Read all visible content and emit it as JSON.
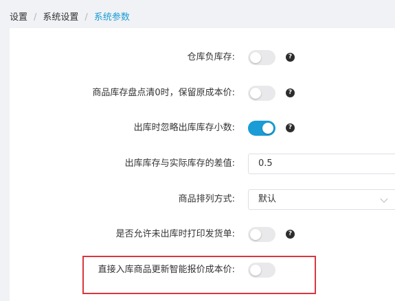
{
  "breadcrumb": {
    "items": [
      "设置",
      "系统设置"
    ],
    "current": "系统参数",
    "separator": "/"
  },
  "settings": {
    "negative_stock": {
      "label": "仓库负库存:",
      "enabled": false,
      "help_icon": "question-circle-icon"
    },
    "keep_cost_on_zero_stock": {
      "label": "商品库存盘点清0时，保留原成本价:",
      "enabled": false,
      "help_icon": "question-circle-icon"
    },
    "ignore_stock_decimals": {
      "label": "出库时忽略出库库存小数:",
      "enabled": true,
      "help_icon": "question-circle-icon"
    },
    "stock_diff": {
      "label": "出库库存与实际库存的差值:",
      "value": "0.5"
    },
    "sort_method": {
      "label": "商品排列方式:",
      "value": "默认",
      "icon": "chevron-down-icon"
    },
    "print_before_outbound": {
      "label": "是否允许未出库时打印发货单:",
      "enabled": false,
      "help_icon": "question-circle-icon"
    },
    "update_quote_cost": {
      "label": "直接入库商品更新智能报价成本价:",
      "enabled": false
    }
  },
  "help_glyph": "?",
  "colors": {
    "accent": "#1a9cd6",
    "toggle_off": "#e9e9eb",
    "highlight_border": "#d9363e",
    "page_bg": "#f0f2f5"
  }
}
